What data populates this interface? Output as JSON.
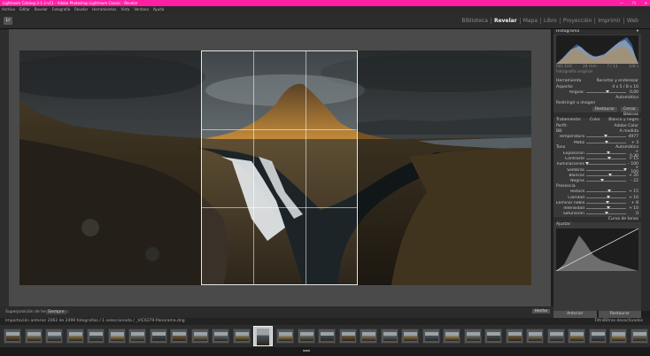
{
  "window": {
    "title": "Lightroom Catalog-3-1-2-v11 - Adobe Photoshop Lightroom Classic - Revelar",
    "buttons": [
      "—",
      "❐",
      "✕"
    ]
  },
  "menubar": [
    "Archivo",
    "Editar",
    "Revelar",
    "Fotografía",
    "Revelar",
    "Herramientas",
    "Vista",
    "Ventana",
    "Ayuda"
  ],
  "logo": "Lr",
  "modules": [
    "Biblioteca",
    "Revelar",
    "Mapa",
    "Libro",
    "Proyección",
    "Imprimir",
    "Web"
  ],
  "active_module": "Revelar",
  "right_panel": {
    "histogram": {
      "title": "Histograma",
      "info": [
        "ISO 100",
        "24 mm",
        "f / 11",
        "1/8 s"
      ],
      "original": "Fotografía original"
    },
    "crop": {
      "title": "Herramienta",
      "mode": "Recortar y enderezar",
      "aspect_label": "Aspecto:",
      "aspect_value": "4 x 5 / 8 x 10",
      "angle_label": "Ángulo:",
      "angle_mode": "Automático",
      "angle_value": "0,00",
      "constrain_label": "Restringir a imagen",
      "reset": "Restaurar",
      "close": "Cerrar"
    },
    "basic": {
      "title": "Básicos",
      "treatment_label": "Tratamiento:",
      "treatment_color": "Color",
      "treatment_bw": "Blanco y negro",
      "profile_label": "Perfil:",
      "profile_value": "Adobe Color",
      "wb_label": "BB:",
      "wb_value": "A medida",
      "sliders_a": [
        {
          "label": "Temperatura",
          "value": "4977",
          "pos": 0.48
        },
        {
          "label": "Matiz",
          "value": "+ 3",
          "pos": 0.52
        }
      ],
      "tone_label": "Tono",
      "tone_auto": "Automático",
      "sliders_b": [
        {
          "label": "Exposición",
          "value": "+ 0,30",
          "pos": 0.55
        },
        {
          "label": "Contraste",
          "value": "+ 15",
          "pos": 0.57
        }
      ],
      "sliders_c": [
        {
          "label": "Iluminaciones",
          "value": "- 100",
          "pos": 0.02
        },
        {
          "label": "Sombras",
          "value": "+ 100",
          "pos": 0.98
        },
        {
          "label": "Blancos",
          "value": "+ 20",
          "pos": 0.6
        },
        {
          "label": "Negros",
          "value": "- 22",
          "pos": 0.39
        }
      ],
      "presence_label": "Presencia",
      "sliders_d": [
        {
          "label": "Textura",
          "value": "+ 15",
          "pos": 0.57
        },
        {
          "label": "Claridad",
          "value": "+ 10",
          "pos": 0.55
        },
        {
          "label": "Eliminar neblina",
          "value": "+ 8",
          "pos": 0.54
        },
        {
          "label": "Intensidad",
          "value": "+ 10",
          "pos": 0.55
        },
        {
          "label": "Saturación",
          "value": "0",
          "pos": 0.5
        }
      ]
    },
    "tone_curve": {
      "title": "Curva de tonos",
      "adjust_label": "Ajustar:"
    },
    "bottom_buttons": [
      "Anterior",
      "Restaurar"
    ]
  },
  "toolbar": {
    "overlay_label": "Superposición de herramientas:",
    "overlay_value": "Siempre",
    "done": "Hecho"
  },
  "filmstrip_bar": {
    "path": "Importación anterior   2062 de 2499 fotografías / 1 seleccionada / _VIC6279-Panorama.dng",
    "filter_label": "Filtro:",
    "filter_value": "Filtros desactivados"
  },
  "colors": {
    "titlebar": "#ff1fa5",
    "panel": "#393939",
    "canvas": "#4a4a4a"
  }
}
